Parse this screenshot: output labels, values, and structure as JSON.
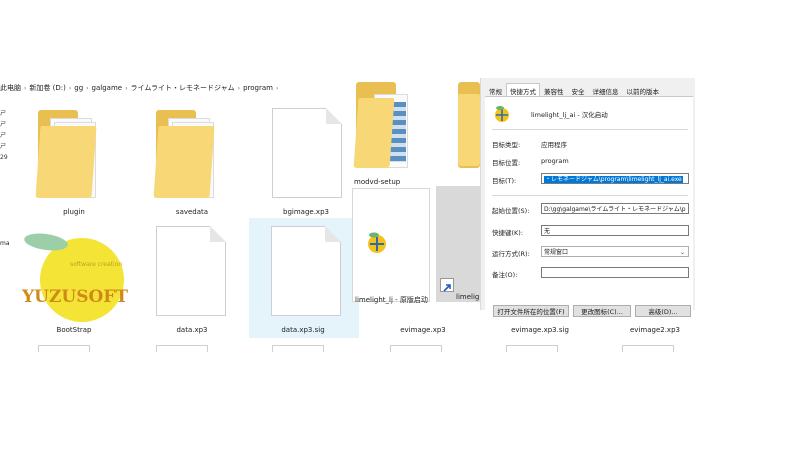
{
  "breadcrumb": [
    "此电脑",
    "新加卷 (D:)",
    "gg",
    "galgame",
    "ライムライト・レモネードジャム",
    "program"
  ],
  "left_panel_marks": [
    "ㄕ",
    "ㄕ",
    "ㄕ",
    "ㄕ",
    "29"
  ],
  "left_panel_mark2": "ma",
  "files": {
    "plugin": "plugin",
    "savedata": "savedata",
    "bgimage": "bgimage.xp3",
    "bootstrap": "BootStrap",
    "data": "data.xp3",
    "datasig": "data.xp3.sig",
    "modvd": "modvd-setup",
    "limelight_orig": "limelight_lj - 原版启动",
    "limelight_short": "limeligh",
    "evimage": "evimage.xp3",
    "evimage_sig": "evimage.xp3.sig",
    "evimage2": "evimage2.xp3"
  },
  "logo": {
    "brand": "YUZUSOFT",
    "tagline": "software creation"
  },
  "dialog": {
    "tabs": [
      "常规",
      "快捷方式",
      "兼容性",
      "安全",
      "详细信息",
      "以前的版本"
    ],
    "active_tab": 1,
    "shortcut_name": "limelight_lj_ai - 汉化启动",
    "target_type_label": "目标类型:",
    "target_type": "应用程序",
    "target_location_label": "目标位置:",
    "target_location": "program",
    "target_label": "目标(T):",
    "target_value": "・レモネードジャム\\program\\limelight_lj_ai.exe",
    "start_in_label": "起始位置(S):",
    "start_in_value": "D:\\gg\\galgame\\ライムライト・レモネードジャム\\p",
    "hotkey_label": "快捷键(K):",
    "hotkey_value": "无",
    "run_label": "运行方式(R):",
    "run_value": "常规窗口",
    "comment_label": "备注(O):",
    "comment_value": "",
    "btn_open_location": "打开文件所在的位置(F)",
    "btn_change_icon": "更改图标(C)...",
    "btn_advanced": "高级(D)..."
  },
  "colors": {
    "folder": "#f8d776",
    "selection": "#0078d7",
    "tile_selected": "#e5f3fb"
  }
}
